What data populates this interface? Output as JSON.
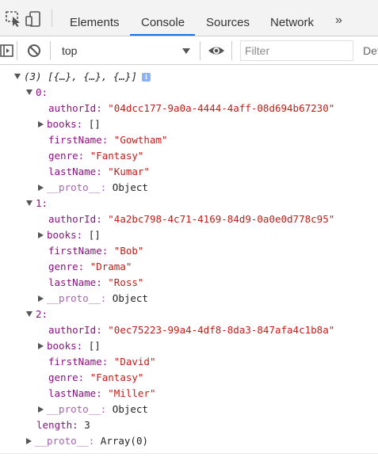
{
  "tabs": {
    "elements": "Elements",
    "console": "Console",
    "sources": "Sources",
    "network": "Network",
    "more": "»"
  },
  "toolbar": {
    "context": "top",
    "filter_placeholder": "Filter",
    "levels": "Def"
  },
  "accent_color": "#1a73e8",
  "console": {
    "summary": "(3) [{…}, {…}, {…}]",
    "info_icon": "i",
    "items": [
      {
        "index": "0:",
        "authorId_key": "authorId:",
        "authorId": "\"04dcc177-9a0a-4444-4aff-08d694b67230\"",
        "books_key": "books:",
        "books": "[]",
        "firstName_key": "firstName:",
        "firstName": "\"Gowtham\"",
        "genre_key": "genre:",
        "genre": "\"Fantasy\"",
        "lastName_key": "lastName:",
        "lastName": "\"Kumar\"",
        "proto_key": "__proto__:",
        "proto": "Object"
      },
      {
        "index": "1:",
        "authorId_key": "authorId:",
        "authorId": "\"4a2bc798-4c71-4169-84d9-0a0e0d778c95\"",
        "books_key": "books:",
        "books": "[]",
        "firstName_key": "firstName:",
        "firstName": "\"Bob\"",
        "genre_key": "genre:",
        "genre": "\"Drama\"",
        "lastName_key": "lastName:",
        "lastName": "\"Ross\"",
        "proto_key": "__proto__:",
        "proto": "Object"
      },
      {
        "index": "2:",
        "authorId_key": "authorId:",
        "authorId": "\"0ec75223-99a4-4df8-8da3-847afa4c1b8a\"",
        "books_key": "books:",
        "books": "[]",
        "firstName_key": "firstName:",
        "firstName": "\"David\"",
        "genre_key": "genre:",
        "genre": "\"Fantasy\"",
        "lastName_key": "lastName:",
        "lastName": "\"Miller\"",
        "proto_key": "__proto__:",
        "proto": "Object"
      }
    ],
    "length_key": "length:",
    "length": "3",
    "array_proto_key": "__proto__:",
    "array_proto": "Array(0)"
  }
}
